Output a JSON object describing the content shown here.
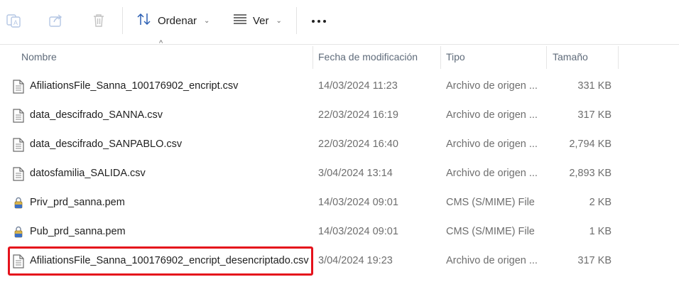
{
  "toolbar": {
    "icons": [
      "translate-icon",
      "share-icon",
      "delete-icon"
    ],
    "sort_label": "Ordenar",
    "view_label": "Ver",
    "more_icon": "more-options-icon"
  },
  "columns": {
    "name": "Nombre",
    "modified": "Fecha de modificación",
    "type": "Tipo",
    "size": "Tamaño"
  },
  "files": [
    {
      "name": "AfiliationsFile_Sanna_100176902_encript.csv",
      "date": "14/03/2024 11:23",
      "type": "Archivo de origen ...",
      "size": "331 KB",
      "icon": "document-icon"
    },
    {
      "name": "data_descifrado_SANNA.csv",
      "date": "22/03/2024 16:19",
      "type": "Archivo de origen ...",
      "size": "317 KB",
      "icon": "document-icon"
    },
    {
      "name": "data_descifrado_SANPABLO.csv",
      "date": "22/03/2024 16:40",
      "type": "Archivo de origen ...",
      "size": "2,794 KB",
      "icon": "document-icon"
    },
    {
      "name": "datosfamilia_SALIDA.csv",
      "date": "3/04/2024 13:14",
      "type": "Archivo de origen ...",
      "size": "2,893 KB",
      "icon": "document-icon"
    },
    {
      "name": "Priv_prd_sanna.pem",
      "date": "14/03/2024 09:01",
      "type": "CMS (S/MIME) File",
      "size": "2 KB",
      "icon": "certificate-lock-icon"
    },
    {
      "name": "Pub_prd_sanna.pem",
      "date": "14/03/2024 09:01",
      "type": "CMS (S/MIME) File",
      "size": "1 KB",
      "icon": "certificate-lock-icon"
    },
    {
      "name": "AfiliationsFile_Sanna_100176902_encript_desencriptado.csv",
      "date": "3/04/2024 19:23",
      "type": "Archivo de origen ...",
      "size": "317 KB",
      "icon": "document-icon"
    }
  ],
  "highlight_color": "#e5121c"
}
